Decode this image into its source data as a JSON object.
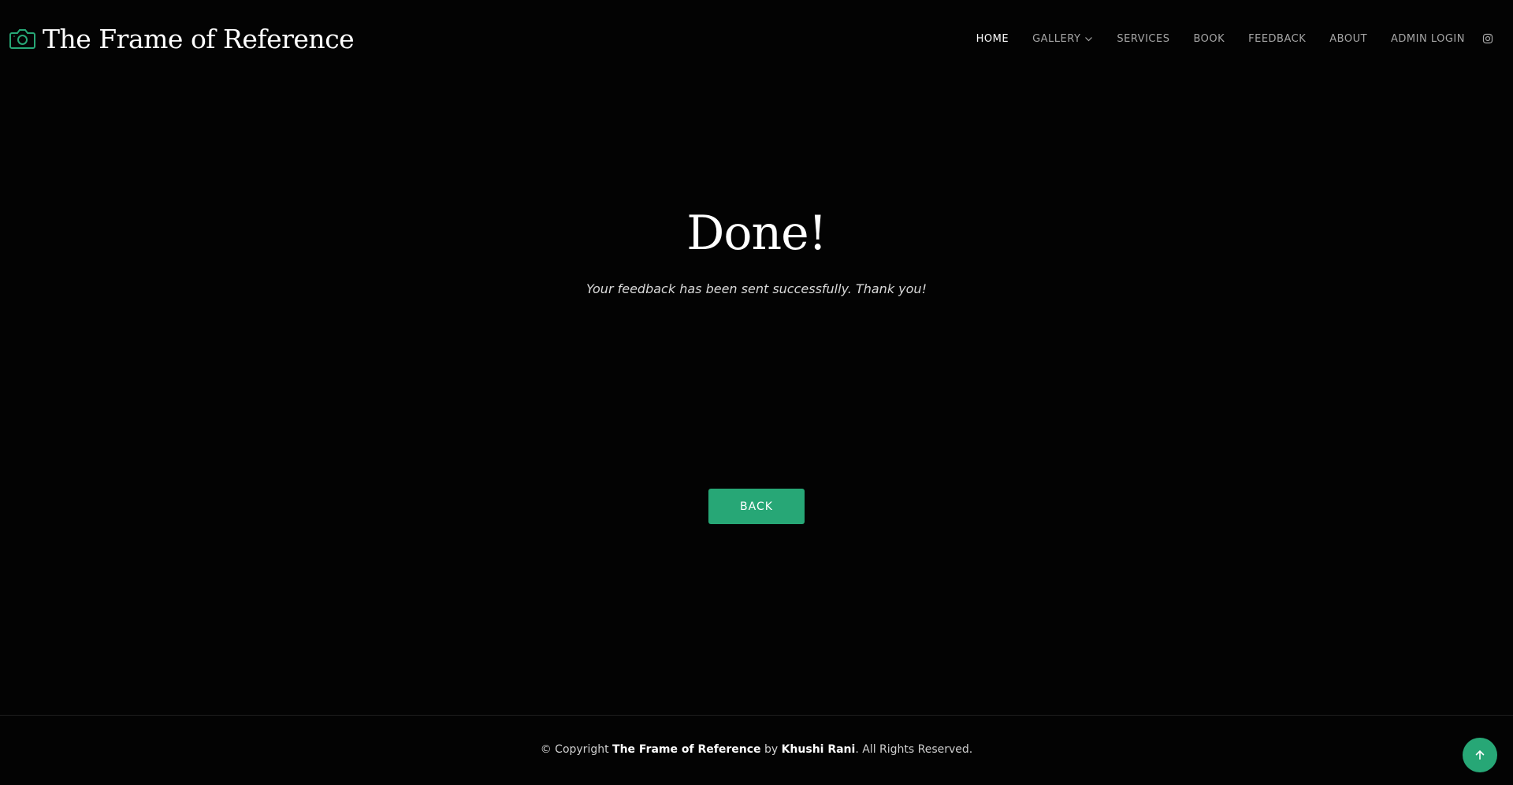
{
  "brand": {
    "name": "The Frame of Reference",
    "icon": "camera-icon",
    "accent_color": "#27a776"
  },
  "nav": {
    "items": [
      {
        "label": "HOME",
        "active": true
      },
      {
        "label": "GALLERY",
        "has_dropdown": true
      },
      {
        "label": "SERVICES"
      },
      {
        "label": "BOOK"
      },
      {
        "label": "FEEDBACK"
      },
      {
        "label": "ABOUT"
      },
      {
        "label": "ADMIN LOGIN"
      }
    ],
    "social_icon": "instagram-icon"
  },
  "main": {
    "title": "Done!",
    "message": "Your feedback has been sent successfully. Thank you!",
    "back_button": "BACK"
  },
  "footer": {
    "prefix": "© Copyright ",
    "site": "The Frame of Reference",
    "by": " by ",
    "author": "Khushi Rani",
    "suffix": ". All Rights Reserved."
  },
  "scroll_top_icon": "arrow-up-icon"
}
